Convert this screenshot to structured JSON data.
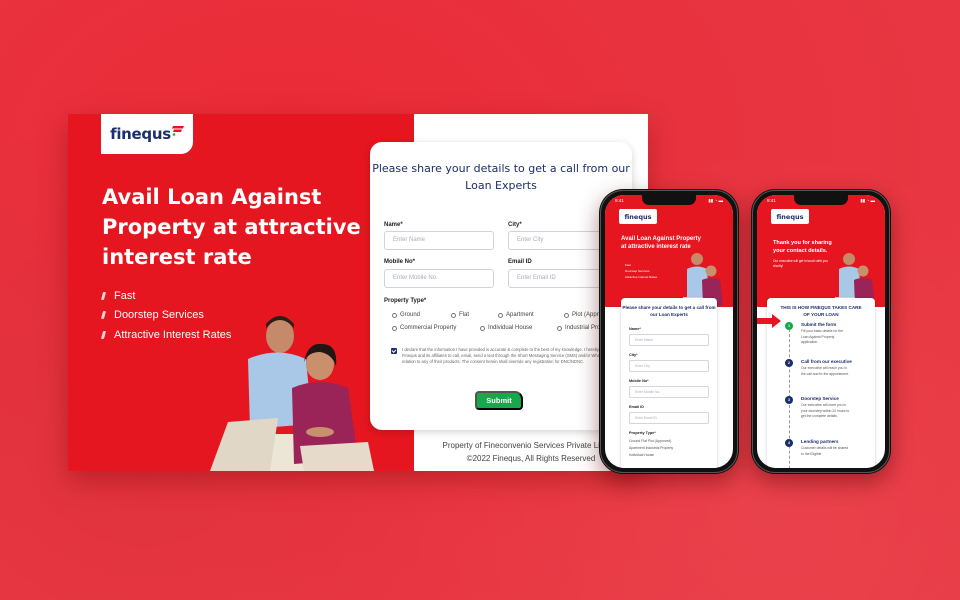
{
  "brand": {
    "name": "finequs",
    "primary_color": "#e5161f",
    "navy_color": "#1c2e6b",
    "success_color": "#16a84a"
  },
  "hero": {
    "title": "Avail Loan Against Property at attractive interest rate",
    "features": [
      "Fast",
      "Doorstep Services",
      "Attractive Interest Rates"
    ]
  },
  "form": {
    "title": "Please share your details to get a call from our Loan Experts",
    "fields": {
      "name": {
        "label": "Name*",
        "placeholder": "Enter Name"
      },
      "city": {
        "label": "City*",
        "placeholder": "Enter City"
      },
      "mobile": {
        "label": "Mobile No*",
        "placeholder": "Enter Mobile No."
      },
      "email": {
        "label": "Email ID",
        "placeholder": "Enter Email ID"
      }
    },
    "property_type": {
      "label": "Property Type*",
      "options": [
        "Ground",
        "Flat",
        "Apartment",
        "Plot (Approved)",
        "Commercial Property",
        "Individual House",
        "Industrial Property"
      ]
    },
    "consent": {
      "checked": true,
      "text": "I declare that the information I have provided is accurate & complete to the best of my knowledge. I hereby authorize Finequs and its affiliates to call, email, send a text through the Short Messaging Service (SMS) and/or WhatsApp me in relation to any of their products. The consent herein shall override any registration for DNC/NDNC."
    },
    "submit_label": "Submit"
  },
  "footer": {
    "line1": "Property of Fineconvenio Services Private Limited",
    "line2": "©2022 Finequs, All Rights Reserved"
  },
  "phone1": {
    "time": "9:41",
    "hero_title": "Avail Loan Against Property at attractive interest rate",
    "features": [
      "Fast",
      "Doorstep Services",
      "Attractive Interest Rates"
    ],
    "form_title": "Please share your details to get a call from our Loan Experts",
    "fields": [
      {
        "label": "Name*",
        "placeholder": "Enter Name"
      },
      {
        "label": "City*",
        "placeholder": "Enter City"
      },
      {
        "label": "Mobile No*",
        "placeholder": "Enter Mobile No."
      },
      {
        "label": "Email ID",
        "placeholder": "Enter Email ID"
      }
    ],
    "property_label": "Property Type*",
    "property_rows": [
      "Ground   Flat   Plot (Approved)",
      "Apartment   Industrial Property",
      "Individual House"
    ]
  },
  "phone2": {
    "time": "9:41",
    "thanks_title": "Thank you for sharing your contact details.",
    "thanks_sub": "Our executive will get in touch with you shortly!",
    "process_title": "THIS IS HOW FINEQUS TAKES CARE OF YOUR LOAN",
    "arrow_label": "You are here",
    "steps": [
      {
        "num": "1",
        "title": "Submit the form",
        "desc": "Fill your basic details for the Loan Against Property application."
      },
      {
        "num": "2",
        "title": "Call from our executive",
        "desc": "Our executive will reach you in the call and fix the appointment."
      },
      {
        "num": "3",
        "title": "Doorstep Service",
        "desc": "Our executive will meet you in your doorstep within 24 hours to get the complete details."
      },
      {
        "num": "4",
        "title": "Lending partners",
        "desc": "Customer details will be shared to the Eligible"
      }
    ]
  }
}
